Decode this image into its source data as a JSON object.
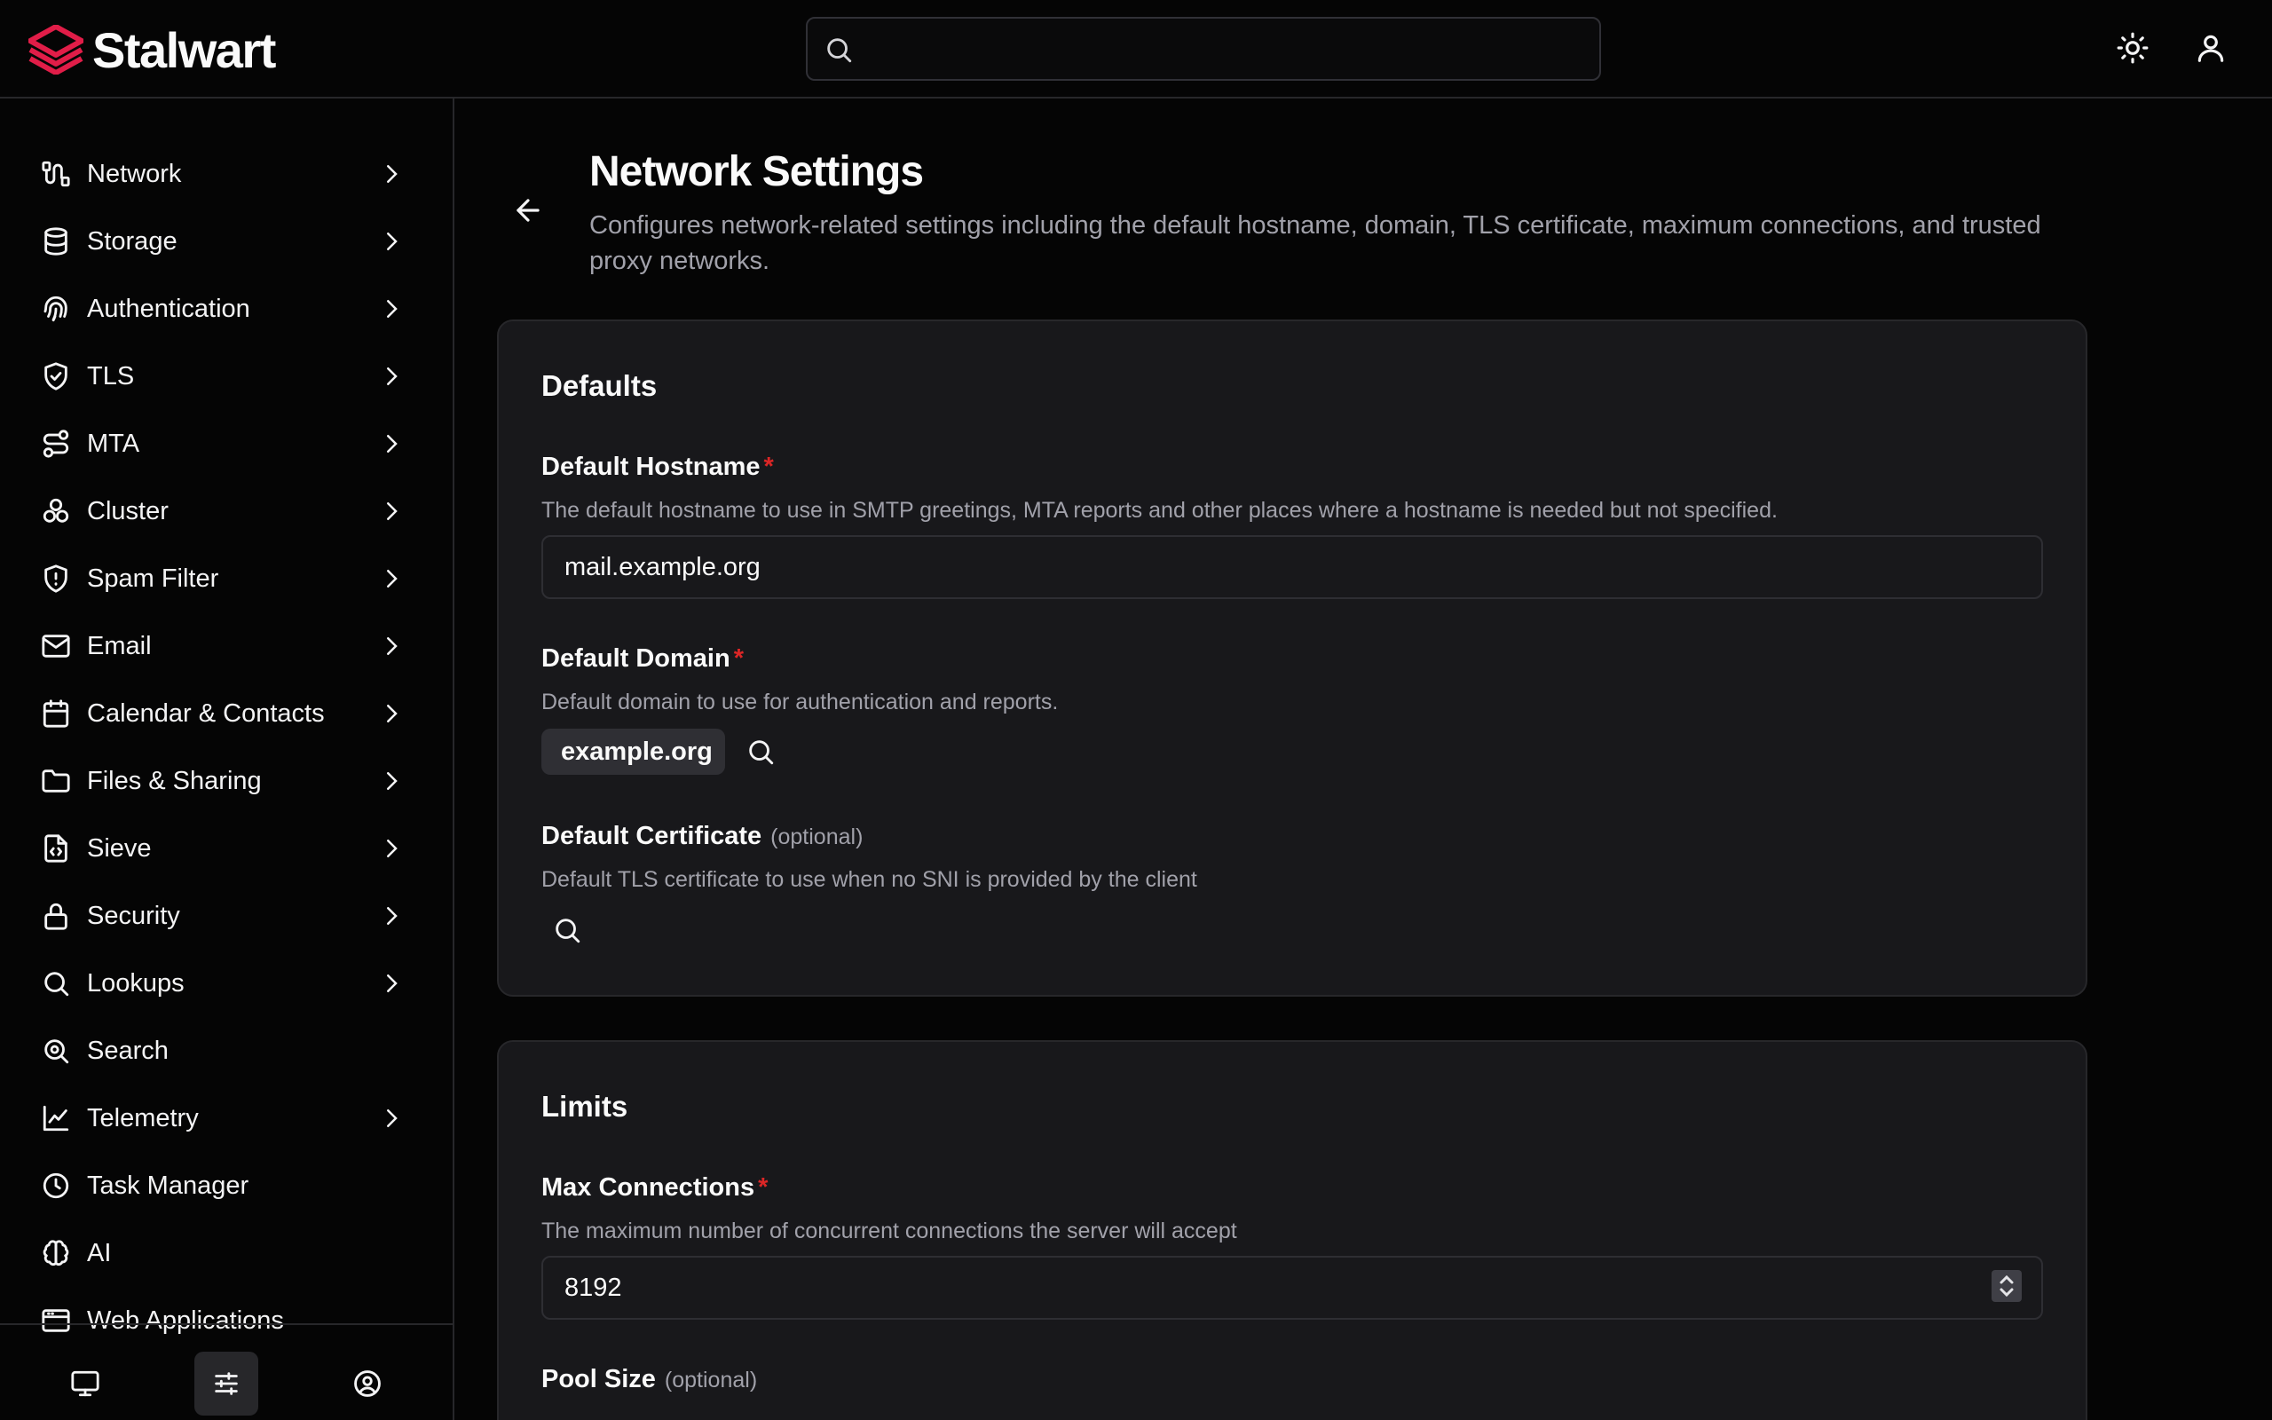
{
  "app": {
    "name": "Stalwart",
    "brand_color": "#e11d48"
  },
  "header": {
    "search_placeholder": "",
    "theme_toggle_icon": "sun-icon",
    "user_menu_icon": "user-icon"
  },
  "sidebar": {
    "items": [
      {
        "label": "Network",
        "icon": "network-icon",
        "expandable": true
      },
      {
        "label": "Storage",
        "icon": "database-icon",
        "expandable": true
      },
      {
        "label": "Authentication",
        "icon": "fingerprint-icon",
        "expandable": true
      },
      {
        "label": "TLS",
        "icon": "shield-check-icon",
        "expandable": true
      },
      {
        "label": "MTA",
        "icon": "route-icon",
        "expandable": true
      },
      {
        "label": "Cluster",
        "icon": "cluster-icon",
        "expandable": true
      },
      {
        "label": "Spam Filter",
        "icon": "shield-alert-icon",
        "expandable": true
      },
      {
        "label": "Email",
        "icon": "mail-icon",
        "expandable": true
      },
      {
        "label": "Calendar & Contacts",
        "icon": "calendar-icon",
        "expandable": true
      },
      {
        "label": "Files & Sharing",
        "icon": "folder-icon",
        "expandable": true
      },
      {
        "label": "Sieve",
        "icon": "file-code-icon",
        "expandable": true
      },
      {
        "label": "Security",
        "icon": "lock-icon",
        "expandable": true
      },
      {
        "label": "Lookups",
        "icon": "search-icon",
        "expandable": true
      },
      {
        "label": "Search",
        "icon": "search-zoom-icon",
        "expandable": false
      },
      {
        "label": "Telemetry",
        "icon": "chart-line-icon",
        "expandable": true
      },
      {
        "label": "Task Manager",
        "icon": "clock-icon",
        "expandable": false
      },
      {
        "label": "AI",
        "icon": "brain-icon",
        "expandable": false
      },
      {
        "label": "Web Applications",
        "icon": "app-window-icon",
        "expandable": false
      }
    ],
    "bottom": [
      {
        "name": "monitor-icon"
      },
      {
        "name": "settings-sliders-icon",
        "active": true
      },
      {
        "name": "account-circle-icon"
      }
    ]
  },
  "page": {
    "title": "Network Settings",
    "description": "Configures network-related settings including the default hostname, domain, TLS certificate, maximum connections, and trusted proxy networks."
  },
  "defaults_card": {
    "title": "Defaults",
    "hostname": {
      "label": "Default Hostname",
      "required_mark": "*",
      "help": "The default hostname to use in SMTP greetings, MTA reports and other places where a hostname is needed but not specified.",
      "value": "mail.example.org"
    },
    "domain": {
      "label": "Default Domain",
      "required_mark": "*",
      "help": "Default domain to use for authentication and reports.",
      "value": "example.org"
    },
    "certificate": {
      "label": "Default Certificate",
      "optional_text": "(optional)",
      "help": "Default TLS certificate to use when no SNI is provided by the client"
    }
  },
  "limits_card": {
    "title": "Limits",
    "max_connections": {
      "label": "Max Connections",
      "required_mark": "*",
      "help": "The maximum number of concurrent connections the server will accept",
      "value": "8192"
    },
    "pool_size": {
      "label": "Pool Size",
      "optional_text": "(optional)"
    }
  }
}
